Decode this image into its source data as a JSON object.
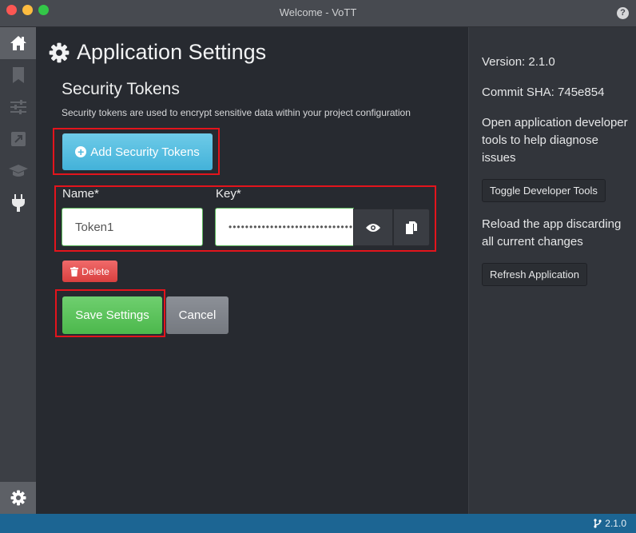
{
  "window": {
    "title": "Welcome - VoTT",
    "help_icon": "question-circle-icon"
  },
  "sidebar": {
    "items": [
      {
        "name": "home",
        "icon": "home-icon",
        "active": true
      },
      {
        "name": "bookmark",
        "icon": "bookmark-icon",
        "active": false
      },
      {
        "name": "sliders",
        "icon": "sliders-icon",
        "active": false
      },
      {
        "name": "export",
        "icon": "external-link-icon",
        "active": false
      },
      {
        "name": "active-learning",
        "icon": "graduation-cap-icon",
        "active": false
      },
      {
        "name": "connections",
        "icon": "plug-icon",
        "active": false
      }
    ],
    "bottom_item": {
      "name": "settings",
      "icon": "gear-icon",
      "active": true
    }
  },
  "main": {
    "page_title": "Application Settings",
    "section_title": "Security Tokens",
    "section_description": "Security tokens are used to encrypt sensitive data within your project configuration",
    "add_button_label": "Add Security Tokens",
    "token": {
      "name_label": "Name*",
      "name_value": "Token1",
      "key_label": "Key*",
      "key_value": "••••••••••••••••••••••••••••••",
      "show_icon": "eye-icon",
      "copy_icon": "copy-icon"
    },
    "delete_button_label": "Delete",
    "save_button_label": "Save Settings",
    "cancel_button_label": "Cancel"
  },
  "right_panel": {
    "version": "Version: 2.1.0",
    "commit": "Commit SHA: 745e854",
    "devtools_description": "Open application developer tools to help diagnose issues",
    "devtools_button": "Toggle Developer Tools",
    "refresh_description": "Reload the app discarding all current changes",
    "refresh_button": "Refresh Application"
  },
  "status_bar": {
    "version": "2.1.0",
    "icon": "code-branch-icon"
  },
  "colors": {
    "accent_info": "#4fb9df",
    "success": "#5cb85c",
    "danger": "#d9403f",
    "status_bar": "#1c6593",
    "highlight_box": "#e3141c"
  }
}
